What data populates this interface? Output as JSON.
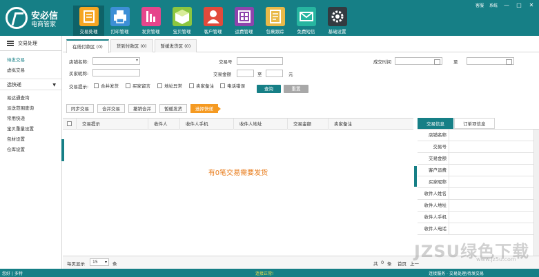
{
  "app": {
    "logo_title": "安必信",
    "logo_sub": "电商管家"
  },
  "header": {
    "nav": [
      {
        "label": "交易处理",
        "icon": "trade-icon",
        "color": "#f5a623"
      },
      {
        "label": "打印管理",
        "icon": "printer-icon",
        "color": "#3d8fd6"
      },
      {
        "label": "发货管理",
        "icon": "shipping-icon",
        "color": "#e6468c"
      },
      {
        "label": "宝贝管理",
        "icon": "package-icon",
        "color": "#8dc63f"
      },
      {
        "label": "客户管理",
        "icon": "customer-icon",
        "color": "#e24a3b"
      },
      {
        "label": "运费管理",
        "icon": "freight-icon",
        "color": "#8e44ad"
      },
      {
        "label": "包裹跟踪",
        "icon": "tracking-icon",
        "color": "#e9b949"
      },
      {
        "label": "免费短信",
        "icon": "sms-icon",
        "color": "#27b5a0"
      },
      {
        "label": "基础设置",
        "icon": "gear-icon",
        "color": "#333a40"
      }
    ],
    "top_links": [
      "客服",
      "系统"
    ],
    "window_controls": [
      "—",
      "□",
      "✕"
    ]
  },
  "sidebar": {
    "title": "交易处理",
    "items_top": [
      "待发交易",
      "虚拟交易"
    ],
    "group": "选快递",
    "items_bottom": [
      "易达通查询",
      "派送范围查询",
      "常用快递",
      "宝贝重量设置",
      "包材设置",
      "仓库设置"
    ]
  },
  "tabs": [
    "在线付款区 (0)",
    "货到付款区 (0)",
    "暂缓发货区 (0)"
  ],
  "filters": {
    "shop_label": "店铺名称:",
    "trade_no_label": "交易号",
    "deal_time_label": "成交时间",
    "to_label": "至",
    "buyer_label": "买家昵称:",
    "amount_label": "交易金额",
    "amount_to": "至",
    "unit": "元",
    "hint_label": "交易提示:",
    "checks": [
      "合并发货",
      "买家留言",
      "地址异常",
      "卖家备注",
      "电话错误"
    ],
    "query": "查询",
    "reset": "重置"
  },
  "actions": [
    "同步交易",
    "合并交易",
    "撤销合并",
    "暂缓发货",
    "选择快递"
  ],
  "grid": {
    "columns": [
      "交易提示",
      "收件人",
      "收件人手机",
      "收件人地址",
      "交易金额",
      "卖家备注"
    ],
    "empty_message": "有0笔交易需要发货"
  },
  "right_panel": {
    "tabs": [
      "交易信息",
      "订单项信息"
    ],
    "fields": [
      "店铺名称",
      "交易号",
      "交易金额",
      "客户运费",
      "买家昵称",
      "收件人姓名",
      "收件人地址",
      "收件人手机",
      "收件人电话"
    ]
  },
  "pager": {
    "per_page_label": "每页显示",
    "per_page": "15",
    "unit": "条",
    "total_prefix": "共",
    "total": "0",
    "total_suffix": "条",
    "first": "首页",
    "prev": "上一"
  },
  "statusbar": {
    "left": "您好 | 多特",
    "center": "连接正常!",
    "right": "连接服务 · 交易处理/待发交易"
  },
  "watermark": {
    "main": "JZSU绿色下载",
    "sub": "www.jz5u.com"
  }
}
